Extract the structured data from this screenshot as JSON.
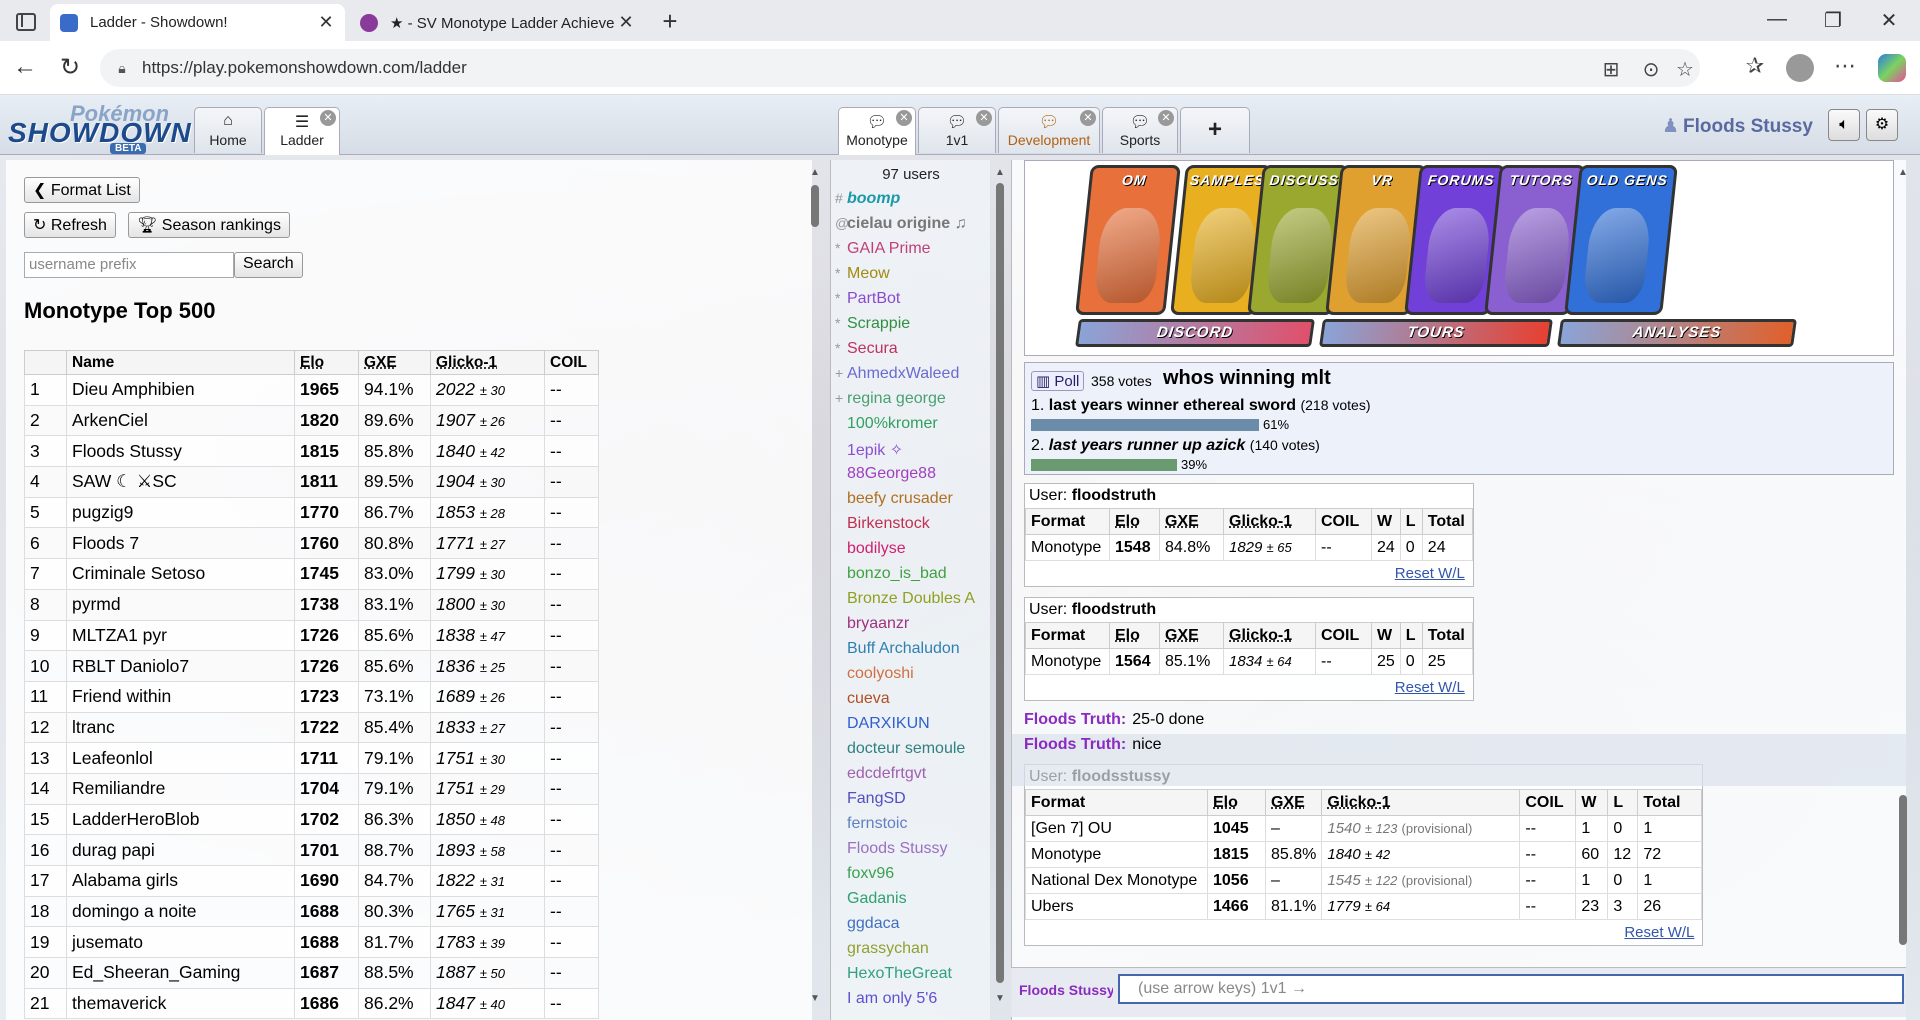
{
  "browser": {
    "tabs": [
      {
        "title": "Ladder - Showdown!",
        "active": true
      },
      {
        "title": "★ - SV Monotype Ladder Achieve",
        "active": false
      }
    ],
    "url": "https://play.pokemonshowdown.com/ladder"
  },
  "header": {
    "logo_top": "Pokémon",
    "logo_main": "SHOWDOWN",
    "logo_beta": "BETA",
    "tabs": [
      {
        "label": "Home"
      },
      {
        "label": "Ladder"
      }
    ],
    "rooms": [
      {
        "label": "Monotype"
      },
      {
        "label": "1v1"
      },
      {
        "label": "Development"
      },
      {
        "label": "Sports"
      }
    ],
    "plus": "+",
    "username": "Floods Stussy"
  },
  "ladder": {
    "format_list_label": "Format List",
    "refresh_label": "Refresh",
    "season_label": "Season rankings",
    "search_placeholder": "username prefix",
    "search_label": "Search",
    "title": "Monotype Top 500",
    "columns": [
      "",
      "Name",
      "Elo",
      "GXE",
      "Glicko-1",
      "COIL"
    ],
    "rows": [
      {
        "rank": "1",
        "name": "Dieu Amphibien",
        "elo": "1965",
        "gxe": "94.1%",
        "glicko": "2022",
        "dev": "± 30",
        "coil": "--"
      },
      {
        "rank": "2",
        "name": "ArkenCiel",
        "elo": "1820",
        "gxe": "89.6%",
        "glicko": "1907",
        "dev": "± 26",
        "coil": "--"
      },
      {
        "rank": "3",
        "name": "Floods Stussy",
        "elo": "1815",
        "gxe": "85.8%",
        "glicko": "1840",
        "dev": "± 42",
        "coil": "--"
      },
      {
        "rank": "4",
        "name": "SAW ☾ ⚔SC",
        "elo": "1811",
        "gxe": "89.5%",
        "glicko": "1904",
        "dev": "± 30",
        "coil": "--"
      },
      {
        "rank": "5",
        "name": "pugzig9",
        "elo": "1770",
        "gxe": "86.7%",
        "glicko": "1853",
        "dev": "± 28",
        "coil": "--"
      },
      {
        "rank": "6",
        "name": "Floods 7",
        "elo": "1760",
        "gxe": "80.8%",
        "glicko": "1771",
        "dev": "± 27",
        "coil": "--"
      },
      {
        "rank": "7",
        "name": "Criminale Setoso",
        "elo": "1745",
        "gxe": "83.0%",
        "glicko": "1799",
        "dev": "± 30",
        "coil": "--"
      },
      {
        "rank": "8",
        "name": "pyrmd",
        "elo": "1738",
        "gxe": "83.1%",
        "glicko": "1800",
        "dev": "± 30",
        "coil": "--"
      },
      {
        "rank": "9",
        "name": "MLTZA1 pyr",
        "elo": "1726",
        "gxe": "85.6%",
        "glicko": "1838",
        "dev": "± 47",
        "coil": "--"
      },
      {
        "rank": "10",
        "name": "RBLT Daniolo7",
        "elo": "1726",
        "gxe": "85.6%",
        "glicko": "1836",
        "dev": "± 25",
        "coil": "--"
      },
      {
        "rank": "11",
        "name": "Friend within",
        "elo": "1723",
        "gxe": "73.1%",
        "glicko": "1689",
        "dev": "± 26",
        "coil": "--"
      },
      {
        "rank": "12",
        "name": "ltranc",
        "elo": "1722",
        "gxe": "85.4%",
        "glicko": "1833",
        "dev": "± 27",
        "coil": "--"
      },
      {
        "rank": "13",
        "name": "Leafeonlol",
        "elo": "1711",
        "gxe": "79.1%",
        "glicko": "1751",
        "dev": "± 30",
        "coil": "--"
      },
      {
        "rank": "14",
        "name": "Remiliandre",
        "elo": "1704",
        "gxe": "79.1%",
        "glicko": "1751",
        "dev": "± 29",
        "coil": "--"
      },
      {
        "rank": "15",
        "name": "LadderHeroBlob",
        "elo": "1702",
        "gxe": "86.3%",
        "glicko": "1850",
        "dev": "± 48",
        "coil": "--"
      },
      {
        "rank": "16",
        "name": "durag papi",
        "elo": "1701",
        "gxe": "88.7%",
        "glicko": "1893",
        "dev": "± 58",
        "coil": "--"
      },
      {
        "rank": "17",
        "name": "Alabama girls",
        "elo": "1690",
        "gxe": "84.7%",
        "glicko": "1822",
        "dev": "± 31",
        "coil": "--"
      },
      {
        "rank": "18",
        "name": "domingo a noite",
        "elo": "1688",
        "gxe": "80.3%",
        "glicko": "1765",
        "dev": "± 31",
        "coil": "--"
      },
      {
        "rank": "19",
        "name": "jusemato",
        "elo": "1688",
        "gxe": "81.7%",
        "glicko": "1783",
        "dev": "± 39",
        "coil": "--"
      },
      {
        "rank": "20",
        "name": "Ed_Sheeran_Gaming",
        "elo": "1687",
        "gxe": "88.5%",
        "glicko": "1887",
        "dev": "± 50",
        "coil": "--"
      },
      {
        "rank": "21",
        "name": "themaverick",
        "elo": "1686",
        "gxe": "86.2%",
        "glicko": "1847",
        "dev": "± 40",
        "coil": "--"
      }
    ]
  },
  "userlist": {
    "count": "97 users",
    "users": [
      {
        "grp": "#",
        "name": "boomp",
        "color": "#1a9aa8",
        "cls": "bot"
      },
      {
        "grp": "@",
        "name": "cielau origine ♫",
        "color": "#777777",
        "cls": "owner"
      },
      {
        "grp": "*",
        "name": "GAIA Prime",
        "color": "#c0407a",
        "cls": ""
      },
      {
        "grp": "*",
        "name": "Meow",
        "color": "#a08a10",
        "cls": ""
      },
      {
        "grp": "*",
        "name": "PartBot",
        "color": "#8a4ad0",
        "cls": ""
      },
      {
        "grp": "*",
        "name": "Scrappie",
        "color": "#309040",
        "cls": ""
      },
      {
        "grp": "*",
        "name": "Secura",
        "color": "#c03060",
        "cls": ""
      },
      {
        "grp": "+",
        "name": "AhmedxWaleed",
        "color": "#6a6ad0",
        "cls": ""
      },
      {
        "grp": "+",
        "name": "regina george",
        "color": "#4aa070",
        "cls": ""
      },
      {
        "grp": "",
        "name": "100%kromer",
        "color": "#30a060",
        "cls": ""
      },
      {
        "grp": "",
        "name": "1epik ✧",
        "color": "#8a50d0",
        "cls": ""
      },
      {
        "grp": "",
        "name": "88George88",
        "color": "#a040c0",
        "cls": ""
      },
      {
        "grp": "",
        "name": "beefy crusader",
        "color": "#b07020",
        "cls": ""
      },
      {
        "grp": "",
        "name": "Birkenstock",
        "color": "#c03050",
        "cls": ""
      },
      {
        "grp": "",
        "name": "bodilyse",
        "color": "#d02070",
        "cls": ""
      },
      {
        "grp": "",
        "name": "bonzo_is_bad",
        "color": "#40a040",
        "cls": ""
      },
      {
        "grp": "",
        "name": "Bronze Doubles A",
        "color": "#90a020",
        "cls": ""
      },
      {
        "grp": "",
        "name": "bryaanzr",
        "color": "#a03080",
        "cls": ""
      },
      {
        "grp": "",
        "name": "Buff Archaludon",
        "color": "#3080b0",
        "cls": ""
      },
      {
        "grp": "",
        "name": "coolyoshi",
        "color": "#d07040",
        "cls": ""
      },
      {
        "grp": "",
        "name": "cueva",
        "color": "#b05020",
        "cls": ""
      },
      {
        "grp": "",
        "name": "DARXIKUN",
        "color": "#3060d0",
        "cls": ""
      },
      {
        "grp": "",
        "name": "docteur semoule",
        "color": "#308080",
        "cls": ""
      },
      {
        "grp": "",
        "name": "edcdefrtgvt",
        "color": "#a060b0",
        "cls": ""
      },
      {
        "grp": "",
        "name": "FangSD",
        "color": "#5050c0",
        "cls": ""
      },
      {
        "grp": "",
        "name": "fernstoic",
        "color": "#6080c0",
        "cls": ""
      },
      {
        "grp": "",
        "name": "Floods Stussy",
        "color": "#9a70c0",
        "cls": ""
      },
      {
        "grp": "",
        "name": "foxv96",
        "color": "#3aa050",
        "cls": ""
      },
      {
        "grp": "",
        "name": "Gadanis",
        "color": "#30a070",
        "cls": ""
      },
      {
        "grp": "",
        "name": "ggdaca",
        "color": "#4070c0",
        "cls": ""
      },
      {
        "grp": "",
        "name": "grassychan",
        "color": "#90a030",
        "cls": ""
      },
      {
        "grp": "",
        "name": "HexoTheGreat",
        "color": "#30a080",
        "cls": ""
      },
      {
        "grp": "",
        "name": "I am only 5'6",
        "color": "#6050d0",
        "cls": ""
      }
    ]
  },
  "chat": {
    "cards": [
      {
        "label": "OM",
        "color": "#e8703a"
      },
      {
        "label": "SAMPLES",
        "color": "#e8b020"
      },
      {
        "label": "DISCUSS",
        "color": "#9aa830"
      },
      {
        "label": "VR",
        "color": "#e0a030"
      },
      {
        "label": "FORUMS",
        "color": "#7040d8"
      },
      {
        "label": "TUTORS",
        "color": "#8a60d0"
      },
      {
        "label": "OLD GENS",
        "color": "#3070d8"
      }
    ],
    "wide_buttons": [
      {
        "label": "DISCORD",
        "color": "#e0506a"
      },
      {
        "label": "TOURS",
        "color": "#e84030"
      },
      {
        "label": "ANALYSES",
        "color": "#e0602a"
      }
    ],
    "poll": {
      "tag": "Poll",
      "votes": "358 votes",
      "question": "whos winning mlt",
      "options": [
        {
          "num": "1.",
          "text": "last years winner ethereal sword",
          "votes": "(218 votes)",
          "pct_label": "61%",
          "pct": 0.61,
          "color": "#6a8ca8",
          "italic": false
        },
        {
          "num": "2.",
          "text": "last years runner up azick",
          "votes": "(140 votes)",
          "pct_label": "39%",
          "pct": 0.39,
          "color": "#6a9a70",
          "italic": true
        }
      ]
    },
    "user_label": "User:",
    "reset_label": "Reset W/L",
    "stat_columns": [
      "Format",
      "Elo",
      "GXE",
      "Glicko-1",
      "COIL",
      "W",
      "L",
      "Total"
    ],
    "user_tables": [
      {
        "user": "floodstruth",
        "rows": [
          {
            "format": "Monotype",
            "elo": "1548",
            "gxe": "84.8%",
            "glicko": "1829",
            "dev": "± 65",
            "prov": "",
            "coil": "--",
            "w": "24",
            "l": "0",
            "total": "24"
          }
        ]
      },
      {
        "user": "floodstruth",
        "rows": [
          {
            "format": "Monotype",
            "elo": "1564",
            "gxe": "85.1%",
            "glicko": "1834",
            "dev": "± 64",
            "prov": "",
            "coil": "--",
            "w": "25",
            "l": "0",
            "total": "25"
          }
        ]
      },
      {
        "user": "floodsstussy",
        "rows": [
          {
            "format": "[Gen 7] OU",
            "elo": "1045",
            "gxe": "–",
            "glicko": "1540",
            "dev": "± 123",
            "prov": "(provisional)",
            "coil": "--",
            "w": "1",
            "l": "0",
            "total": "1"
          },
          {
            "format": "Monotype",
            "elo": "1815",
            "gxe": "85.8%",
            "glicko": "1840",
            "dev": "± 42",
            "prov": "",
            "coil": "--",
            "w": "60",
            "l": "12",
            "total": "72"
          },
          {
            "format": "National Dex Monotype",
            "elo": "1056",
            "gxe": "–",
            "glicko": "1545",
            "dev": "± 122",
            "prov": "(provisional)",
            "coil": "--",
            "w": "1",
            "l": "0",
            "total": "1"
          },
          {
            "format": "Ubers",
            "elo": "1466",
            "gxe": "81.1%",
            "glicko": "1779",
            "dev": "± 64",
            "prov": "",
            "coil": "--",
            "w": "23",
            "l": "3",
            "total": "26"
          }
        ]
      }
    ],
    "messages": [
      {
        "who": "Floods Truth:",
        "text": "25-0 done"
      },
      {
        "who": "Floods Truth:",
        "text": "nice"
      }
    ],
    "input_name": "Floods Stussy",
    "input_placeholder": "(use arrow keys) 1v1 →"
  }
}
